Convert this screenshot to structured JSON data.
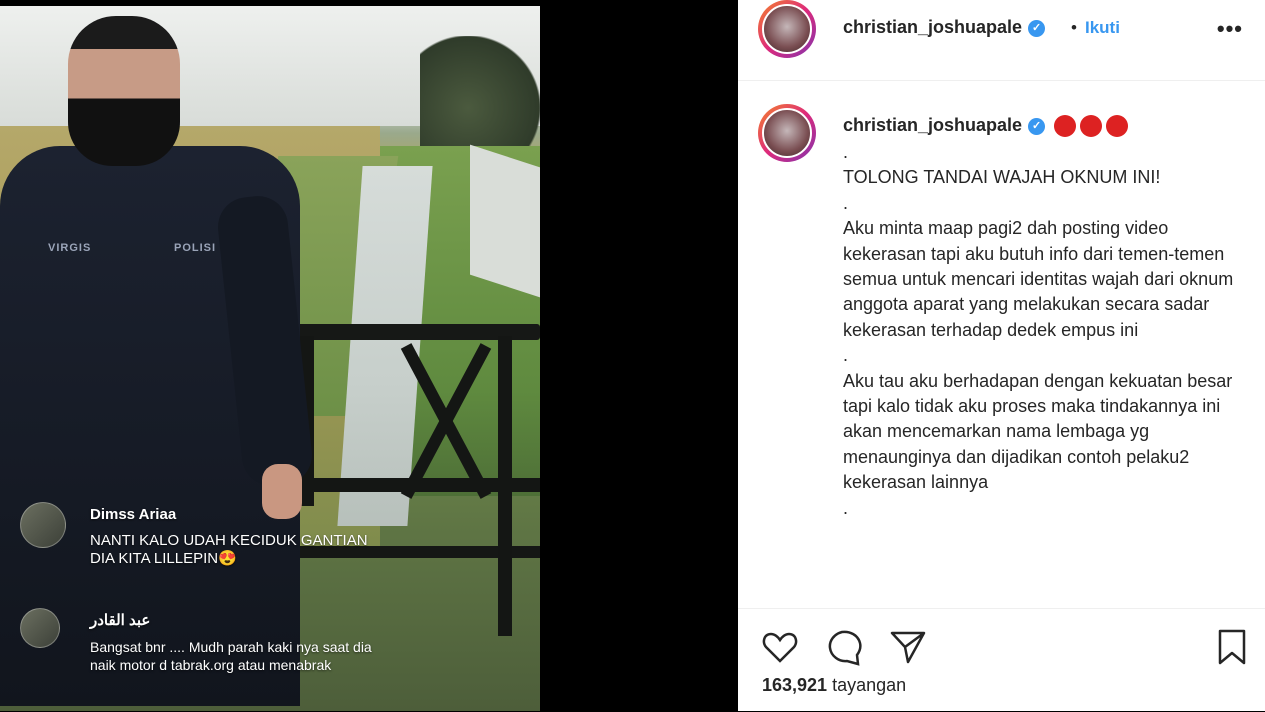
{
  "post": {
    "username": "christian_joshuapale",
    "follow_label": "Ikuti",
    "more_label": "•••",
    "caption_lines": [
      ".",
      "TOLONG TANDAI WAJAH OKNUM INI!",
      ".",
      "Aku minta maap pagi2 dah posting video kekerasan tapi aku butuh info dari temen-temen semua untuk mencari identitas wajah dari oknum anggota aparat yang melakukan secara sadar kekerasan terhadap dedek empus ini",
      ".",
      "Aku tau aku berhadapan dengan kekuatan besar tapi kalo tidak aku proses maka tindakannya ini akan mencemarkan nama lembaga yg menaunginya dan dijadikan contoh pelaku2 kekerasan lainnya",
      "."
    ],
    "views_count": "163,921",
    "views_label": "tayangan",
    "colors": {
      "link": "#3897f0",
      "verified": "#3897f0",
      "text": "#262626"
    }
  },
  "video": {
    "comments": [
      {
        "name": "Dimss Ariaa",
        "text": "NANTI KALO UDAH KECIDUK GANTIAN DIA KITA LILLEPIN😍"
      },
      {
        "name": "عبد القادر",
        "text": "Bangsat bnr .... Mudh parah kaki nya saat dia naik motor d tabrak.org atau menabrak"
      }
    ],
    "patch_left": "VIRGIS",
    "patch_right": "POLISI"
  },
  "icons": [
    "heart-icon",
    "comment-icon",
    "share-icon",
    "bookmark-icon",
    "verified-icon"
  ]
}
